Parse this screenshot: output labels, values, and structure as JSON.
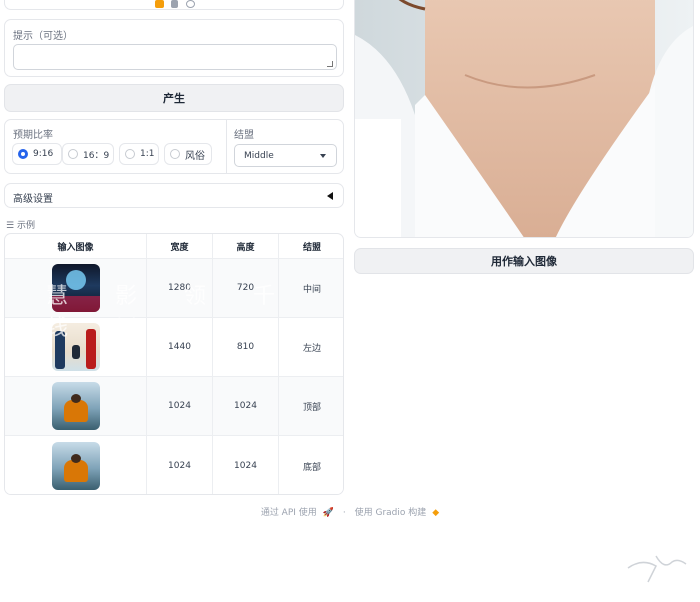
{
  "prompt": {
    "label": "提示（可选）",
    "value": "",
    "placeholder": ""
  },
  "generate_label": "产生",
  "ratio": {
    "label": "预期比率",
    "options": [
      "9:16",
      "16：9",
      "1:1",
      "风俗"
    ],
    "selected": "9:16"
  },
  "position": {
    "label": "结盟",
    "value": "Middle"
  },
  "advanced_label": "高级设置",
  "examples": {
    "label": "示例",
    "headers": [
      "输入图像",
      "宽度",
      "高度",
      "结盟"
    ],
    "rows": [
      {
        "width": "1280",
        "height": "720",
        "align": "中间"
      },
      {
        "width": "1440",
        "height": "810",
        "align": "左边"
      },
      {
        "width": "1024",
        "height": "1024",
        "align": "顶部"
      },
      {
        "width": "1024",
        "height": "1024",
        "align": "底部"
      }
    ]
  },
  "watermark_text": "慧 影 领 千 线 川",
  "use_as_input_label": "用作输入图像",
  "footer": {
    "api": "通过 API 使用",
    "sep": "·",
    "built": "使用 Gradio 构建"
  },
  "colors": {
    "accent": "#2563eb",
    "button_bg": "#f0f1f3",
    "border": "#e5e7eb",
    "text": "#374151"
  },
  "icons": [
    "rocket-icon",
    "gradio-logo-icon",
    "chevron-down-icon",
    "triangle-left-icon",
    "menu-icon"
  ]
}
